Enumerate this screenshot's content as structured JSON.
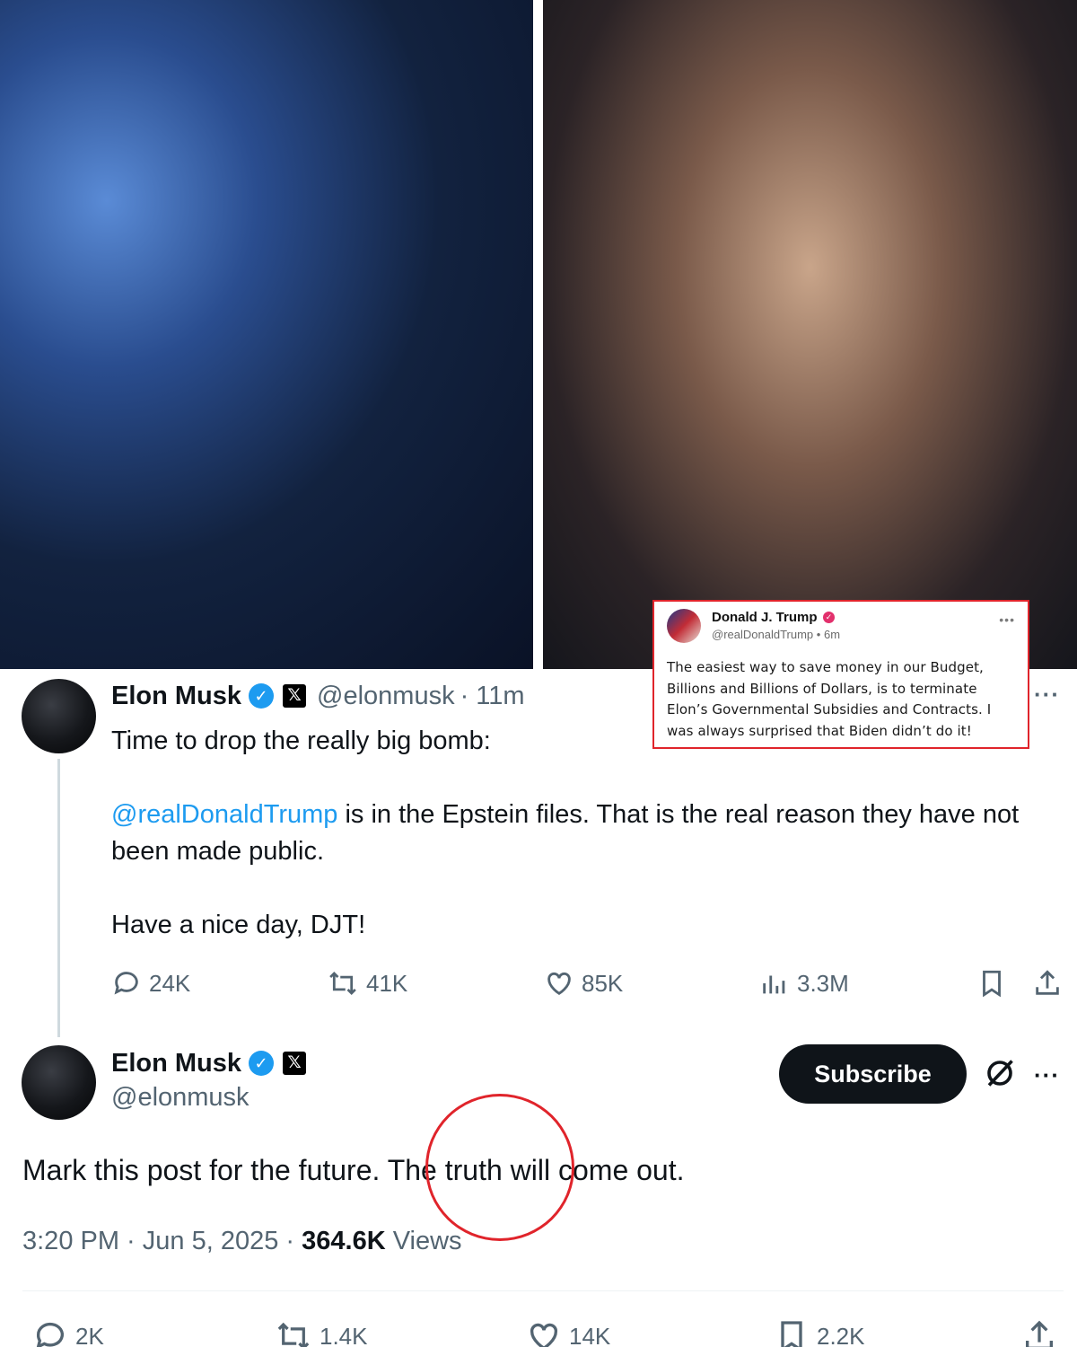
{
  "truth_post": {
    "name": "Donald J. Trump",
    "handle": "@realDonaldTrump",
    "time": "6m",
    "text": "The easiest way to save money in our Budget, Billions and Billions of Dollars, is to terminate Elon’s Governmental Subsidies and Contracts. I was always surprised that Biden didn’t do it!",
    "icons": [
      "verified-badge-icon",
      "more-icon"
    ]
  },
  "tweet1": {
    "name": "Elon Musk",
    "handle": "@elonmusk",
    "time": "· 11m",
    "line1": "Time to drop the really big bomb:",
    "mention": "@realDonaldTrump",
    "line2": " is in the Epstein files. That is the real reason they have not been made public.",
    "line3": "Have a nice day, DJT!",
    "stats": {
      "replies": "24K",
      "reposts": "41K",
      "likes": "85K",
      "views": "3.3M"
    }
  },
  "tweet2": {
    "name": "Elon Musk",
    "handle": "@elonmusk",
    "subscribe_label": "Subscribe",
    "text": "Mark this post for the future. The truth will come out.",
    "time": "3:20 PM · Jun 5, 2025 · ",
    "views_count": "364.6K",
    "views_label": " Views",
    "stats": {
      "replies": "2K",
      "reposts": "1.4K",
      "likes": "14K",
      "bookmarks": "2.2K"
    }
  },
  "colors": {
    "accent": "#1d9bf0",
    "annotation_red": "#e0242b",
    "secondary_text": "#536471"
  }
}
